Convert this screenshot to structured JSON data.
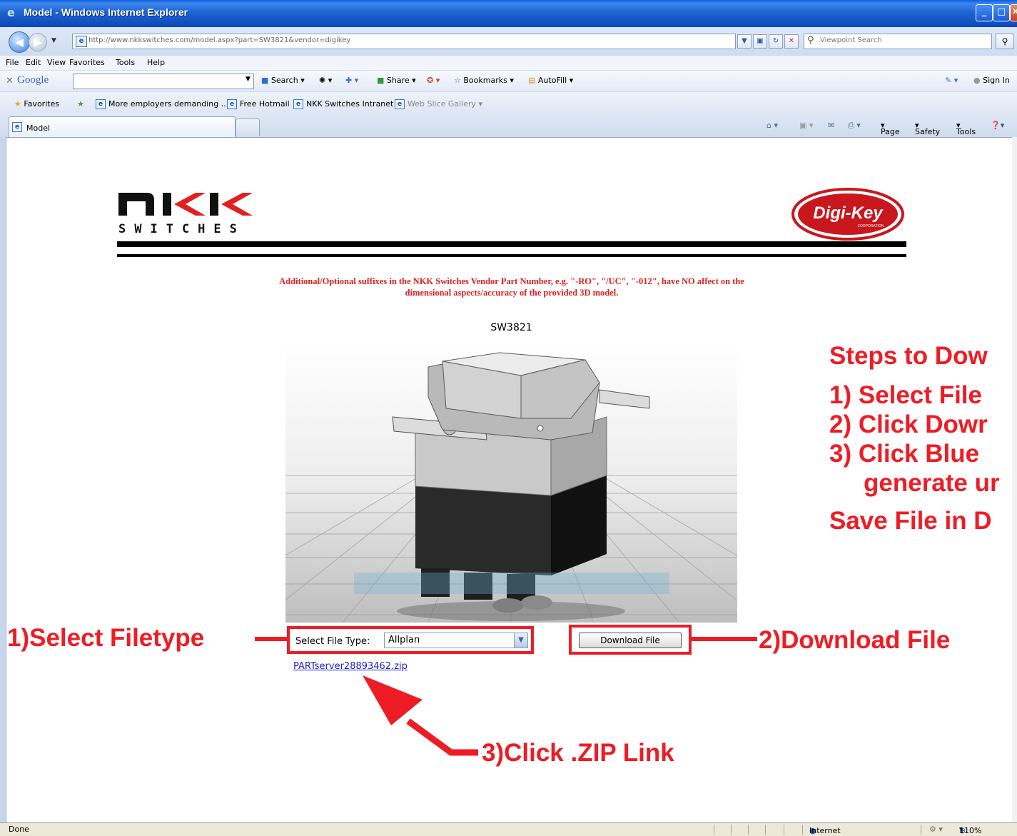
{
  "window": {
    "title": "Model - Windows Internet Explorer"
  },
  "address_bar": {
    "url": "http://www.nkkswitches.com/model.aspx?part=SW3821&vendor=digikey",
    "search_placeholder": "Viewpoint Search"
  },
  "menu": [
    "File",
    "Edit",
    "View",
    "Favorites",
    "Tools",
    "Help"
  ],
  "google_toolbar": {
    "brand": "Google",
    "search_label": "Search",
    "share_label": "Share",
    "bookmarks_label": "Bookmarks",
    "autofill_label": "AutoFill",
    "sign_in_label": "Sign In"
  },
  "favorites_bar": {
    "favorites_label": "Favorites",
    "links": [
      "More employers demanding ...",
      "Free Hotmail",
      "NKK Switches Intranet",
      "Web Slice Gallery"
    ]
  },
  "tabs": {
    "active_label": "Model"
  },
  "command_bar": {
    "page_label": "Page",
    "safety_label": "Safety",
    "tools_label": "Tools"
  },
  "page": {
    "logo_left_text": "SWITCHES",
    "logo_right_text": "Digi-Key",
    "logo_right_sub": "CORPORATION",
    "notice_line1": "Additional/Optional suffixes in the NKK Switches Vendor Part Number, e.g. \"-RO\", \"/UC\", \"-012\", have NO affect on the",
    "notice_line2": "dimensional aspects/accuracy of the provided 3D model.",
    "part_number": "SW3821",
    "file_type_label": "Select File Type:",
    "file_type_value": "Allplan",
    "download_button": "Download File",
    "zip_link": "PARTserver28893462.zip"
  },
  "annotations": {
    "step1": "1)Select Filetype",
    "step2": "2)Download File",
    "step3": "3)Click .ZIP Link",
    "steps_title": "Steps to Dow",
    "steps_1": "1) Select File",
    "steps_2": "2) Click Dowr",
    "steps_3": "3) Click Blue",
    "steps_3b": "generate ur",
    "steps_save": "Save File in D"
  },
  "status_bar": {
    "status": "Done",
    "zone": "Internet",
    "zoom": "110%"
  },
  "colors": {
    "annotation_red": "#ee1c24",
    "notice_red": "#e0201f",
    "titlebar_blue": "#0a5fd8",
    "link_blue": "#1f1fcc"
  }
}
